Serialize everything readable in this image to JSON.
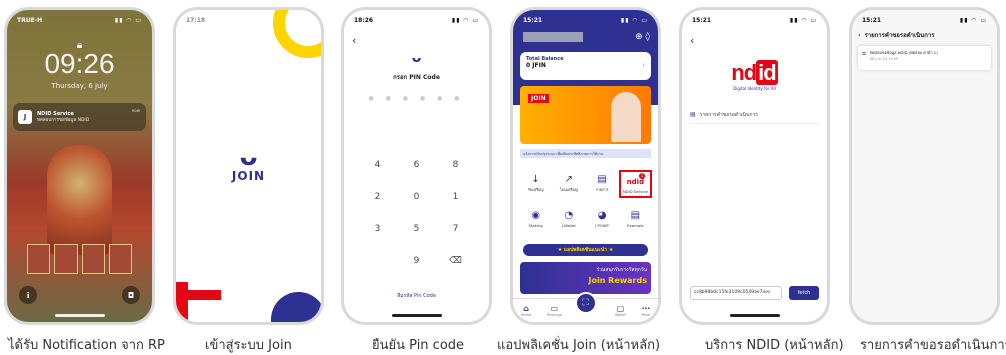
{
  "captions": [
    "ได้รับ Notification จาก RP",
    "เข้าสู่ระบบ Join",
    "ยืนยัน Pin code",
    "แอปพลิเคชั่น Join (หน้าหลัก)",
    "บริการ NDID (หน้าหลัก)",
    "รายการคำขอรอดำเนินการ"
  ],
  "lockscreen": {
    "carrier": "TRUE-H",
    "time": "09:26",
    "date": "Thursday, 6 July",
    "notification": {
      "app": "J",
      "title": "NDID Service",
      "body": "ทดสอบการขอข้อมูล NDID",
      "when": "now"
    }
  },
  "splash": {
    "status_time": "17:18",
    "logo_mark": "ᴗ",
    "logo_text": "JOIN"
  },
  "pin": {
    "status_time": "18:26",
    "back": "‹",
    "title": "กรอก PIN Code",
    "dots": "● ● ● ● ● ●",
    "keys": [
      "4",
      "6",
      "8",
      "2",
      "0",
      "1",
      "3",
      "5",
      "7",
      "",
      "9",
      "⌫"
    ],
    "forgot": "ลืมรหัส Pin Code"
  },
  "home": {
    "status_time": "15:21",
    "balance_label": "Total Balance",
    "balance_value": "0 JFIN",
    "banner_badge": "JOIN",
    "ticker": "แจ้งการปรับปรุงระบบ เพื่อเพิ่มประสิทธิภาพการใช้งาน",
    "services": [
      {
        "icon": "↓",
        "label": "รับเหรียญ"
      },
      {
        "icon": "↗",
        "label": "โอนเหรียญ"
      },
      {
        "icon": "▤",
        "label": "รายการ"
      },
      {
        "icon": "ndid",
        "label": "NDID Service",
        "badge": "1"
      },
      {
        "icon": "◉",
        "label": "Staking"
      },
      {
        "icon": "◔",
        "label": "J-Wallet"
      },
      {
        "icon": "◕",
        "label": "J POINT"
      },
      {
        "icon": "▤",
        "label": "Example"
      }
    ],
    "promo": "★ แอปพลิเคชันแนะนำ ★",
    "rewards_title": "ร่วมสนุกรับรางวัลทุกวัน",
    "rewards_text": "Join Rewards",
    "tabs": [
      {
        "icon": "⌂",
        "label": "Home"
      },
      {
        "icon": "▭",
        "label": "Privilege"
      },
      {
        "icon": "▢",
        "label": "Wallet"
      },
      {
        "icon": "⋯",
        "label": "More"
      }
    ],
    "scan": "⛶"
  },
  "ndid": {
    "status_time": "15:21",
    "back": "‹",
    "logo_left": "nd",
    "logo_right": "id",
    "subtitle": "Digital Identity for All",
    "menu_item": "รายการคำขอรอดำเนินการ",
    "input_value": "cc8b98b0c15fe3109c0549ae7aec",
    "fetch": "fetch"
  },
  "requests": {
    "status_time": "15:21",
    "back": "‹",
    "title": "รายการคำขอรอดำเนินการ",
    "item_title": "ทดสอบขอข้อมูล NDID (ทดสอบ ดาต้า 1)",
    "item_date": "06 ก.ค. 23 15:59"
  }
}
